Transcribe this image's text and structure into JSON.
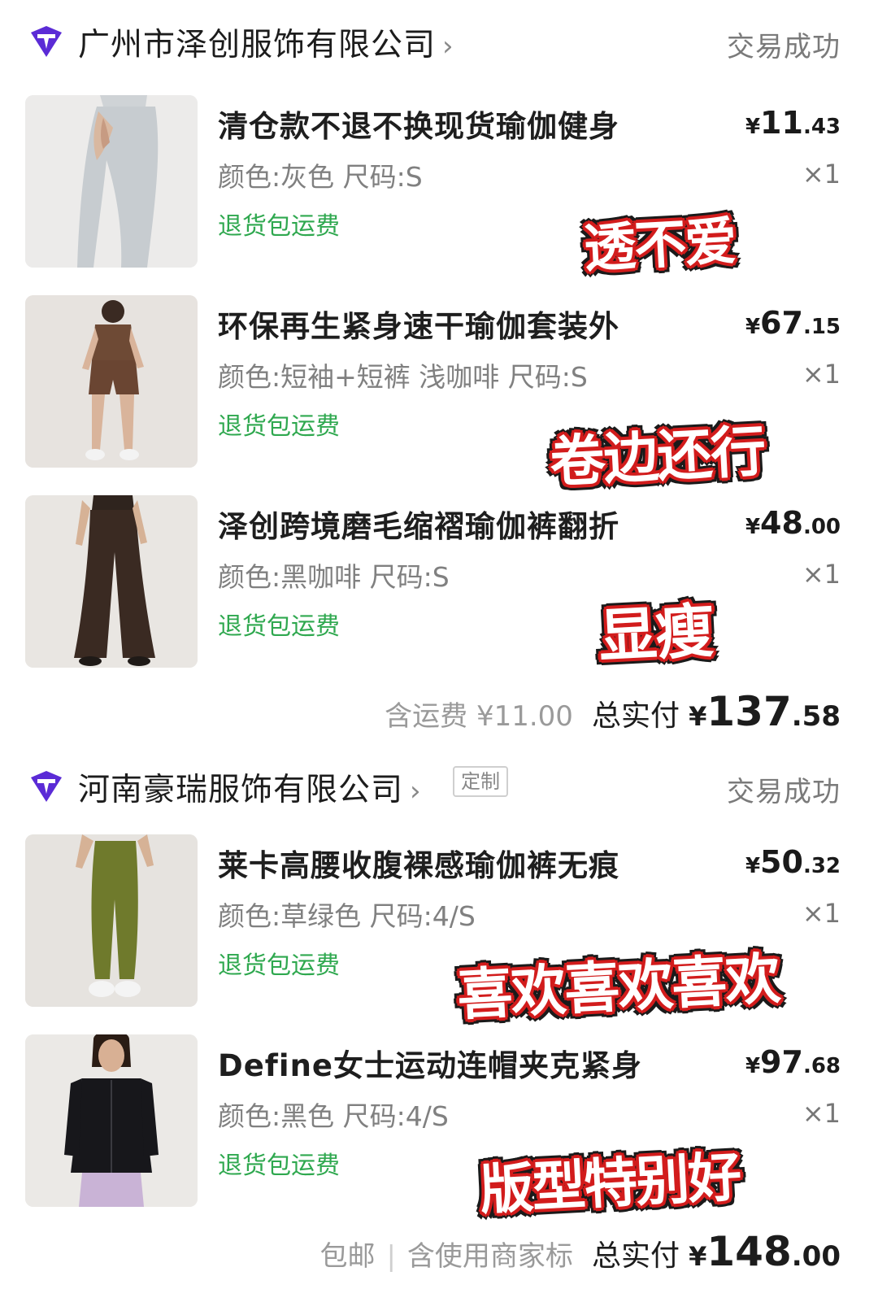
{
  "shops": [
    {
      "name": "广州市泽创服饰有限公司",
      "status": "交易成功",
      "custom_badge": "",
      "items": [
        {
          "title": "清仓款不退不换现货瑜伽健身",
          "spec": "颜色:灰色 尺码:S",
          "tag": "退货包运费",
          "price_currency": "¥",
          "price_int": "11",
          "price_dec": ".43",
          "qty": "×1",
          "sticker": "透不爱",
          "image_icon": "grey-leggings-photo"
        },
        {
          "title": "环保再生紧身速干瑜伽套装外",
          "spec": "颜色:短袖+短裤 浅咖啡 尺码:S",
          "tag": "退货包运费",
          "price_currency": "¥",
          "price_int": "67",
          "price_dec": ".15",
          "qty": "×1",
          "sticker": "卷边还行",
          "image_icon": "brown-shorts-set-photo"
        },
        {
          "title": "泽创跨境磨毛缩褶瑜伽裤翻折",
          "spec": "颜色:黑咖啡 尺码:S",
          "tag": "退货包运费",
          "price_currency": "¥",
          "price_int": "48",
          "price_dec": ".00",
          "qty": "×1",
          "sticker": "显瘦",
          "image_icon": "flare-pants-photo"
        }
      ],
      "summary": {
        "shipping_note": "含运费 ¥11.00",
        "total_label": "总实付",
        "total_currency": "¥",
        "total_int": "137",
        "total_dec": ".58"
      }
    },
    {
      "name": "河南豪瑞服饰有限公司",
      "status": "交易成功",
      "custom_badge": "定制",
      "items": [
        {
          "title": "莱卡高腰收腹裸感瑜伽裤无痕",
          "spec": "颜色:草绿色 尺码:4/S",
          "tag": "退货包运费",
          "price_currency": "¥",
          "price_int": "50",
          "price_dec": ".32",
          "qty": "×1",
          "sticker": "喜欢喜欢喜欢",
          "image_icon": "green-leggings-photo"
        },
        {
          "title": "Define女士运动连帽夹克紧身",
          "spec": "颜色:黑色 尺码:4/S",
          "tag": "退货包运费",
          "price_currency": "¥",
          "price_int": "97",
          "price_dec": ".68",
          "qty": "×1",
          "sticker": "版型特别好",
          "image_icon": "black-jacket-photo"
        }
      ],
      "summary": {
        "shipping_note": "包邮",
        "extra_note": "含使用商家标",
        "total_label": "总实付",
        "total_currency": "¥",
        "total_int": "148",
        "total_dec": ".00"
      }
    }
  ],
  "colors": {
    "tag_green": "#2fa84f",
    "sticker_red": "#d21c1c",
    "logo_purple": "#5b2bd6"
  }
}
